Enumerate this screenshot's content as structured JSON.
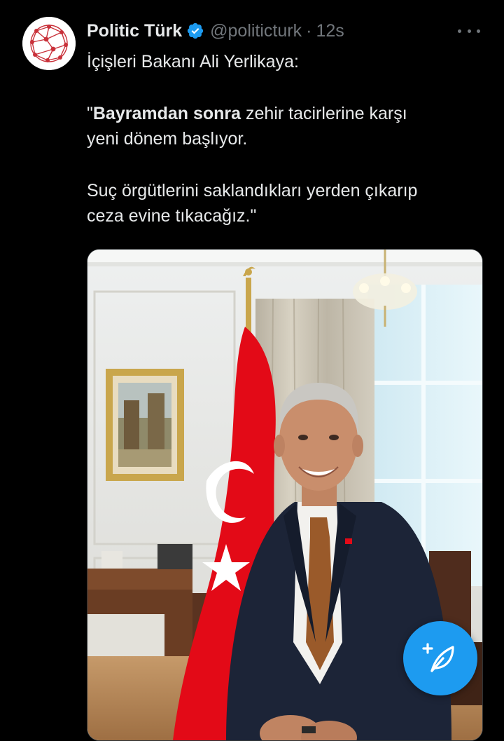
{
  "account": {
    "display_name": "Politic Türk",
    "handle": "@politicturk",
    "separator": "·",
    "timestamp": "12s",
    "verified": true
  },
  "tweet": {
    "line1": "İçişleri Bakanı Ali Yerlikaya:",
    "quote_open": "\"",
    "quote_bold": "Bayramdan sonra",
    "quote_rest_1": " zehir tacirlerine karşı",
    "quote_line2": "yeni dönem başlıyor.",
    "para2_line1": "Suç örgütlerini saklandıkları yerden çıkarıp",
    "para2_line2": "ceza evine tıkacağız.\""
  },
  "colors": {
    "background": "#000000",
    "text": "#e7e9ea",
    "secondary": "#71767b",
    "accent": "#1d9bf0",
    "flag_red": "#e30a17"
  },
  "icons": {
    "avatar": "network-logo-icon",
    "verified": "verified-badge-icon",
    "more": "more-options-icon",
    "compose": "compose-post-icon"
  }
}
